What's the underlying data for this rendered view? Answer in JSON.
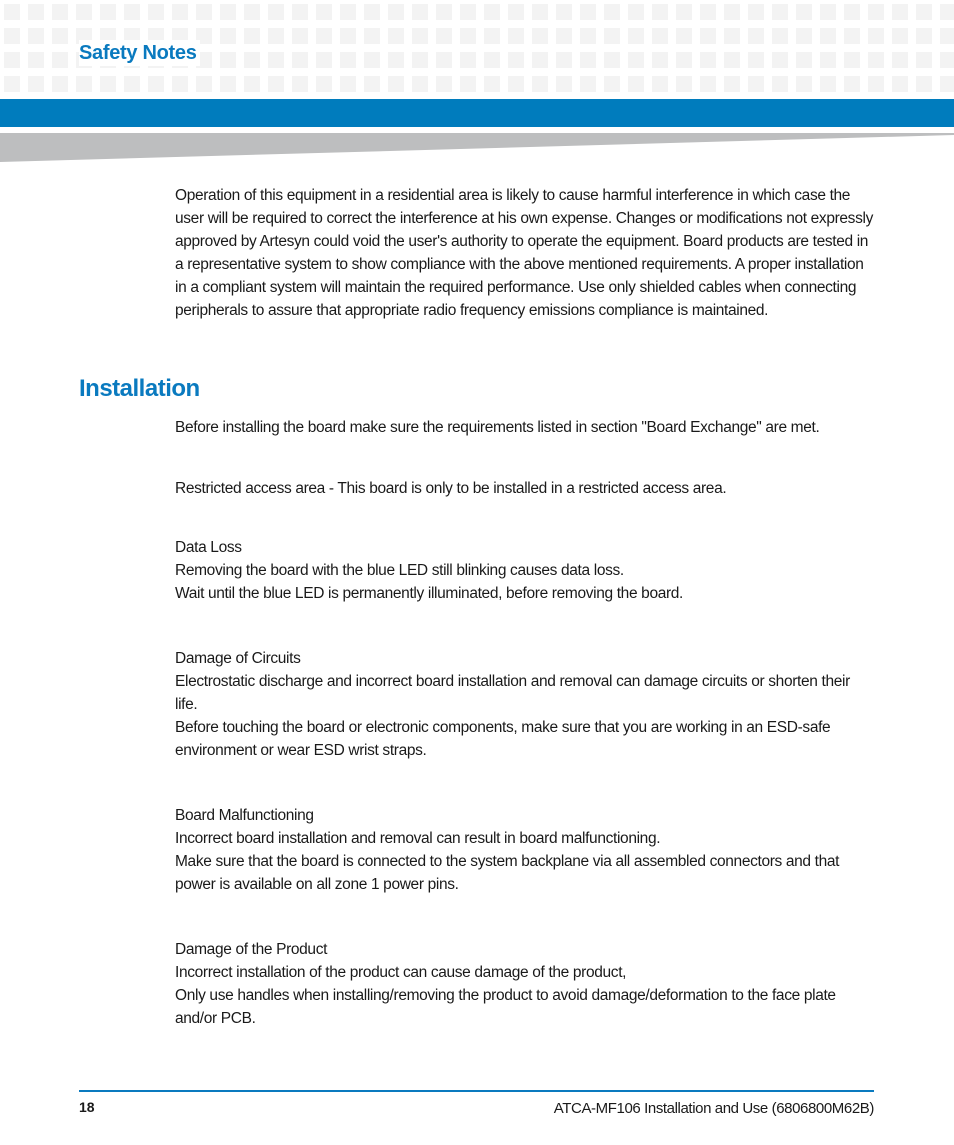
{
  "header": {
    "chapter_title": "Safety Notes",
    "colors": {
      "accent_blue": "#007cbd",
      "heading_blue": "#0a7abf",
      "wedge_gray": "#bdbebf",
      "grid_gray": "#f3f3f3"
    }
  },
  "intro_paragraph": "Operation of this equipment in a residential area is likely to cause harmful interference in which case the user will be required to correct the interference at his own expense. Changes or modifications not expressly approved by Artesyn could void the user's authority to operate the equipment. Board products are tested in a representative system to show compliance with the above mentioned requirements. A proper installation in a compliant system will maintain the required performance. Use only shielded cables when connecting peripherals to assure that appropriate radio frequency emissions compliance is maintained.",
  "installation": {
    "heading": "Installation",
    "paragraphs": [
      "Before installing the board make sure the requirements listed in section \"Board Exchange\" are met.",
      "Restricted access area - This board is only to be installed in a restricted access area."
    ],
    "notices": [
      {
        "title": "Data Loss",
        "lines": [
          "Removing the board with the blue LED still blinking causes data loss.",
          "Wait until the blue LED is permanently illuminated, before removing the board."
        ]
      },
      {
        "title": "Damage of Circuits",
        "lines": [
          "Electrostatic discharge and incorrect board installation and removal can damage circuits or shorten their life.",
          "Before touching the board or electronic components, make sure that you are working in an ESD-safe environment or wear ESD wrist straps."
        ]
      },
      {
        "title": "Board Malfunctioning",
        "lines": [
          "Incorrect board installation and removal can result in board malfunctioning.",
          "Make sure that the board is connected to the system backplane via all assembled connectors and that power is available on all zone 1 power pins."
        ]
      },
      {
        "title": "Damage of the Product",
        "lines": [
          "Incorrect installation of the product can cause damage of the product,",
          "Only use handles when installing/removing the product to avoid damage/deformation to the face plate and/or PCB."
        ]
      }
    ]
  },
  "footer": {
    "page_number": "18",
    "document_title": "ATCA-MF106 Installation and Use (6806800M62B)"
  }
}
